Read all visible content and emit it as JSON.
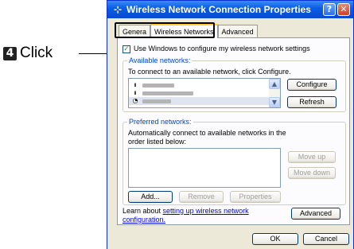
{
  "callout": {
    "step_number": "4",
    "label": "Click"
  },
  "window": {
    "title": "Wireless Network Connection Properties",
    "help_glyph": "?",
    "close_glyph": "✕"
  },
  "tabs": [
    {
      "label": "General",
      "display": "Genera"
    },
    {
      "label": "Wireless Networks"
    },
    {
      "label": "Advanced"
    }
  ],
  "use_windows_checkbox": {
    "checked": true,
    "label": "Use Windows to configure my wireless network settings"
  },
  "available_networks": {
    "title": "Available networks:",
    "instruction": "To connect to an available network, click Configure.",
    "configure_label": "Configure",
    "refresh_label": "Refresh"
  },
  "preferred_networks": {
    "title": "Preferred networks:",
    "instruction": "Automatically connect to available networks in the order listed below:",
    "move_up_label": "Move up",
    "move_down_label": "Move down",
    "add_label": "Add...",
    "remove_label": "Remove",
    "properties_label": "Properties"
  },
  "learn_about": {
    "prefix": "Learn about ",
    "link_text": "setting up wireless network configuration.",
    "advanced_label": "Advanced"
  },
  "footer": {
    "ok_label": "OK",
    "cancel_label": "Cancel"
  }
}
